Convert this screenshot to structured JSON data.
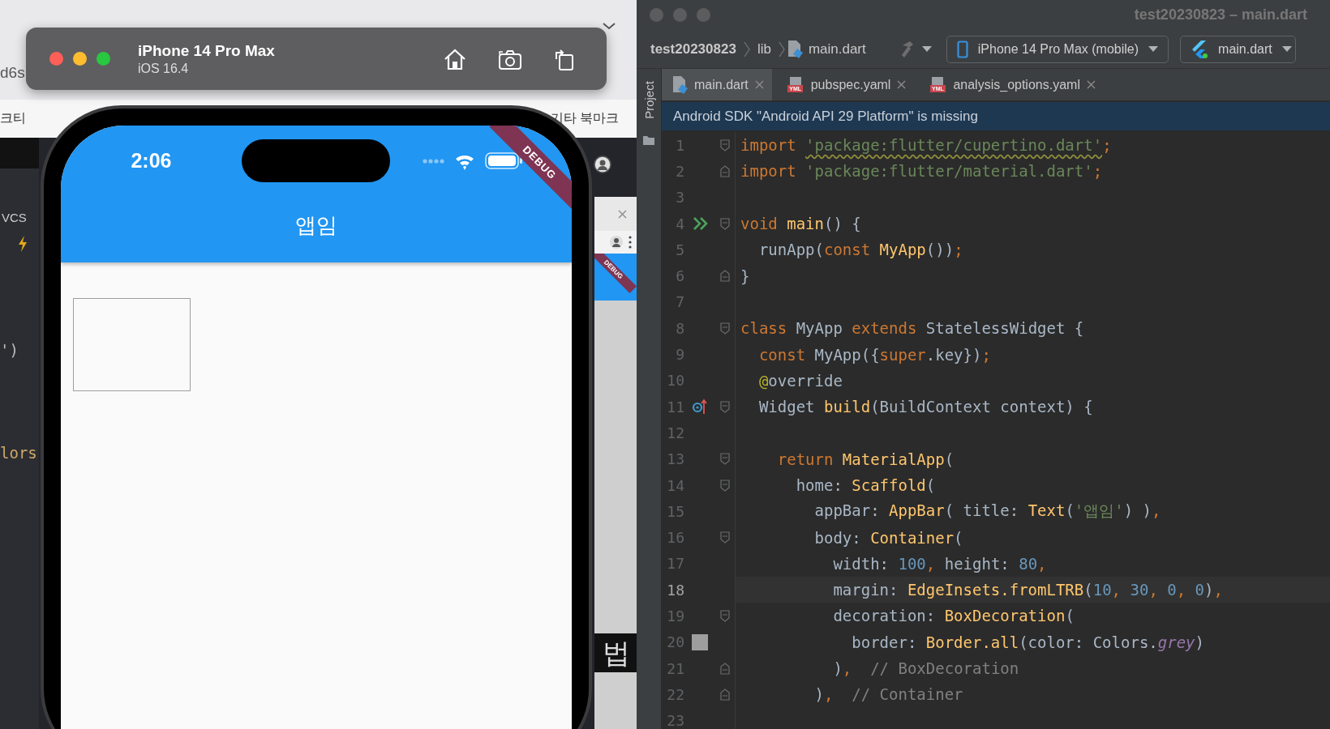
{
  "background": {
    "address_fragment": "d6s",
    "bookmarks": [
      "크티",
      "기타 북마크"
    ],
    "ide_menu_fragment": "VCS",
    "ide_code_fragments": [
      "')",
      "lors"
    ],
    "simulator_banner": "DEBUG",
    "simulator_caption": "법"
  },
  "simulator": {
    "device": "iPhone 14 Pro Max",
    "os": "iOS 16.4"
  },
  "app": {
    "time": "2:06",
    "title": "앱임",
    "debug_banner": "DEBUG"
  },
  "ide": {
    "title": "test20230823 – main.dart",
    "breadcrumbs": [
      {
        "label": "test20230823",
        "kind": "project"
      },
      {
        "label": "lib",
        "kind": "folder"
      },
      {
        "label": "main.dart",
        "kind": "file"
      }
    ],
    "device_selector": "iPhone 14 Pro Max (mobile)",
    "run_config": "main.dart",
    "tool_window": "Project",
    "tabs": [
      {
        "label": "main.dart",
        "kind": "dart",
        "selected": true
      },
      {
        "label": "pubspec.yaml",
        "kind": "yaml",
        "icon_text": "YML",
        "selected": false
      },
      {
        "label": "analysis_options.yaml",
        "kind": "yaml",
        "icon_text": "YML",
        "selected": false
      }
    ],
    "banner": "Android SDK \"Android API 29 Platform\" is missing",
    "lines": [
      {
        "number": "1",
        "fold_open": true,
        "tokens": [
          {
            "kind": "kw",
            "text": "import "
          },
          {
            "kind": "str",
            "text": "'package:flutter/cupertino.dart'",
            "warning": true
          },
          {
            "kind": "kw",
            "text": ";"
          }
        ]
      },
      {
        "number": "2",
        "fold_close": true,
        "tokens": [
          {
            "kind": "kw",
            "text": "import "
          },
          {
            "kind": "str",
            "text": "'package:flutter/material.dart'"
          },
          {
            "kind": "kw",
            "text": ";"
          }
        ]
      },
      {
        "number": "3"
      },
      {
        "number": "4",
        "run_marker": true,
        "fold_open": true,
        "tokens": [
          {
            "kind": "kw",
            "text": "void "
          },
          {
            "kind": "fn",
            "text": "main"
          },
          {
            "kind": "plain",
            "text": "() {"
          }
        ]
      },
      {
        "number": "5",
        "tokens": [
          {
            "kind": "plain",
            "text": "  runApp("
          },
          {
            "kind": "kw",
            "text": "const "
          },
          {
            "kind": "fn",
            "text": "MyApp"
          },
          {
            "kind": "plain",
            "text": "())"
          },
          {
            "kind": "kw",
            "text": ";"
          }
        ]
      },
      {
        "number": "6",
        "fold_close": true,
        "tokens": [
          {
            "kind": "plain",
            "text": "}"
          }
        ]
      },
      {
        "number": "7"
      },
      {
        "number": "8",
        "fold_open": true,
        "tokens": [
          {
            "kind": "kw",
            "text": "class "
          },
          {
            "kind": "plain",
            "text": "MyApp "
          },
          {
            "kind": "kw",
            "text": "extends "
          },
          {
            "kind": "plain",
            "text": "StatelessWidget {"
          }
        ]
      },
      {
        "number": "9",
        "tokens": [
          {
            "kind": "kw",
            "text": "  const "
          },
          {
            "kind": "plain",
            "text": "MyApp({"
          },
          {
            "kind": "kw",
            "text": "super"
          },
          {
            "kind": "plain",
            "text": ".key})"
          },
          {
            "kind": "kw",
            "text": ";"
          }
        ]
      },
      {
        "number": "10",
        "tokens": [
          {
            "kind": "ann",
            "text": "  @"
          },
          {
            "kind": "plain",
            "text": "override"
          }
        ]
      },
      {
        "number": "11",
        "override_marker": true,
        "fold_open": true,
        "tokens": [
          {
            "kind": "plain",
            "text": "  Widget "
          },
          {
            "kind": "fn",
            "text": "build"
          },
          {
            "kind": "plain",
            "text": "(BuildContext context) {"
          }
        ]
      },
      {
        "number": "12"
      },
      {
        "number": "13",
        "fold_open": true,
        "tokens": [
          {
            "kind": "kw",
            "text": "    return "
          },
          {
            "kind": "fn",
            "text": "MaterialApp"
          },
          {
            "kind": "plain",
            "text": "("
          }
        ]
      },
      {
        "number": "14",
        "fold_open": true,
        "tokens": [
          {
            "kind": "plain",
            "text": "      home: "
          },
          {
            "kind": "fn",
            "text": "Scaffold"
          },
          {
            "kind": "plain",
            "text": "("
          }
        ]
      },
      {
        "number": "15",
        "tokens": [
          {
            "kind": "plain",
            "text": "        appBar: "
          },
          {
            "kind": "fn",
            "text": "AppBar"
          },
          {
            "kind": "plain",
            "text": "( title: "
          },
          {
            "kind": "fn",
            "text": "Text"
          },
          {
            "kind": "plain",
            "text": "("
          },
          {
            "kind": "str",
            "text": "'앱임'"
          },
          {
            "kind": "plain",
            "text": ") )"
          },
          {
            "kind": "kw",
            "text": ","
          }
        ]
      },
      {
        "number": "16",
        "fold_open": true,
        "tokens": [
          {
            "kind": "plain",
            "text": "        body: "
          },
          {
            "kind": "fn",
            "text": "Container"
          },
          {
            "kind": "plain",
            "text": "("
          }
        ]
      },
      {
        "number": "17",
        "tokens": [
          {
            "kind": "plain",
            "text": "          width: "
          },
          {
            "kind": "num",
            "text": "100"
          },
          {
            "kind": "kw",
            "text": ", "
          },
          {
            "kind": "plain",
            "text": "height: "
          },
          {
            "kind": "num",
            "text": "80"
          },
          {
            "kind": "kw",
            "text": ","
          }
        ]
      },
      {
        "number": "18",
        "current": true,
        "tokens": [
          {
            "kind": "plain",
            "text": "          margin: "
          },
          {
            "kind": "fn",
            "text": "EdgeInsets.fromLTRB"
          },
          {
            "kind": "plain",
            "text": "("
          },
          {
            "kind": "num",
            "text": "10"
          },
          {
            "kind": "kw",
            "text": ", "
          },
          {
            "kind": "num",
            "text": "30"
          },
          {
            "kind": "kw",
            "text": ", "
          },
          {
            "kind": "num",
            "text": "0"
          },
          {
            "kind": "kw",
            "text": ", "
          },
          {
            "kind": "num",
            "text": "0"
          },
          {
            "kind": "plain",
            "text": ")"
          },
          {
            "kind": "kw",
            "text": ","
          }
        ]
      },
      {
        "number": "19",
        "fold_open": true,
        "tokens": [
          {
            "kind": "plain",
            "text": "          decoration: "
          },
          {
            "kind": "fn",
            "text": "BoxDecoration"
          },
          {
            "kind": "plain",
            "text": "("
          }
        ]
      },
      {
        "number": "20",
        "color_swatch": true,
        "tokens": [
          {
            "kind": "plain",
            "text": "            border: "
          },
          {
            "kind": "fn",
            "text": "Border.all"
          },
          {
            "kind": "plain",
            "text": "(color: Colors."
          },
          {
            "kind": "field",
            "text": "grey"
          },
          {
            "kind": "plain",
            "text": ")"
          }
        ]
      },
      {
        "number": "21",
        "fold_close": true,
        "tokens": [
          {
            "kind": "plain",
            "text": "          )"
          },
          {
            "kind": "kw",
            "text": ","
          },
          {
            "kind": "cmt",
            "text": "  // BoxDecoration"
          }
        ]
      },
      {
        "number": "22",
        "fold_close": true,
        "tokens": [
          {
            "kind": "plain",
            "text": "        )"
          },
          {
            "kind": "kw",
            "text": ","
          },
          {
            "kind": "cmt",
            "text": "  // Container"
          }
        ]
      },
      {
        "number": "23"
      }
    ]
  }
}
